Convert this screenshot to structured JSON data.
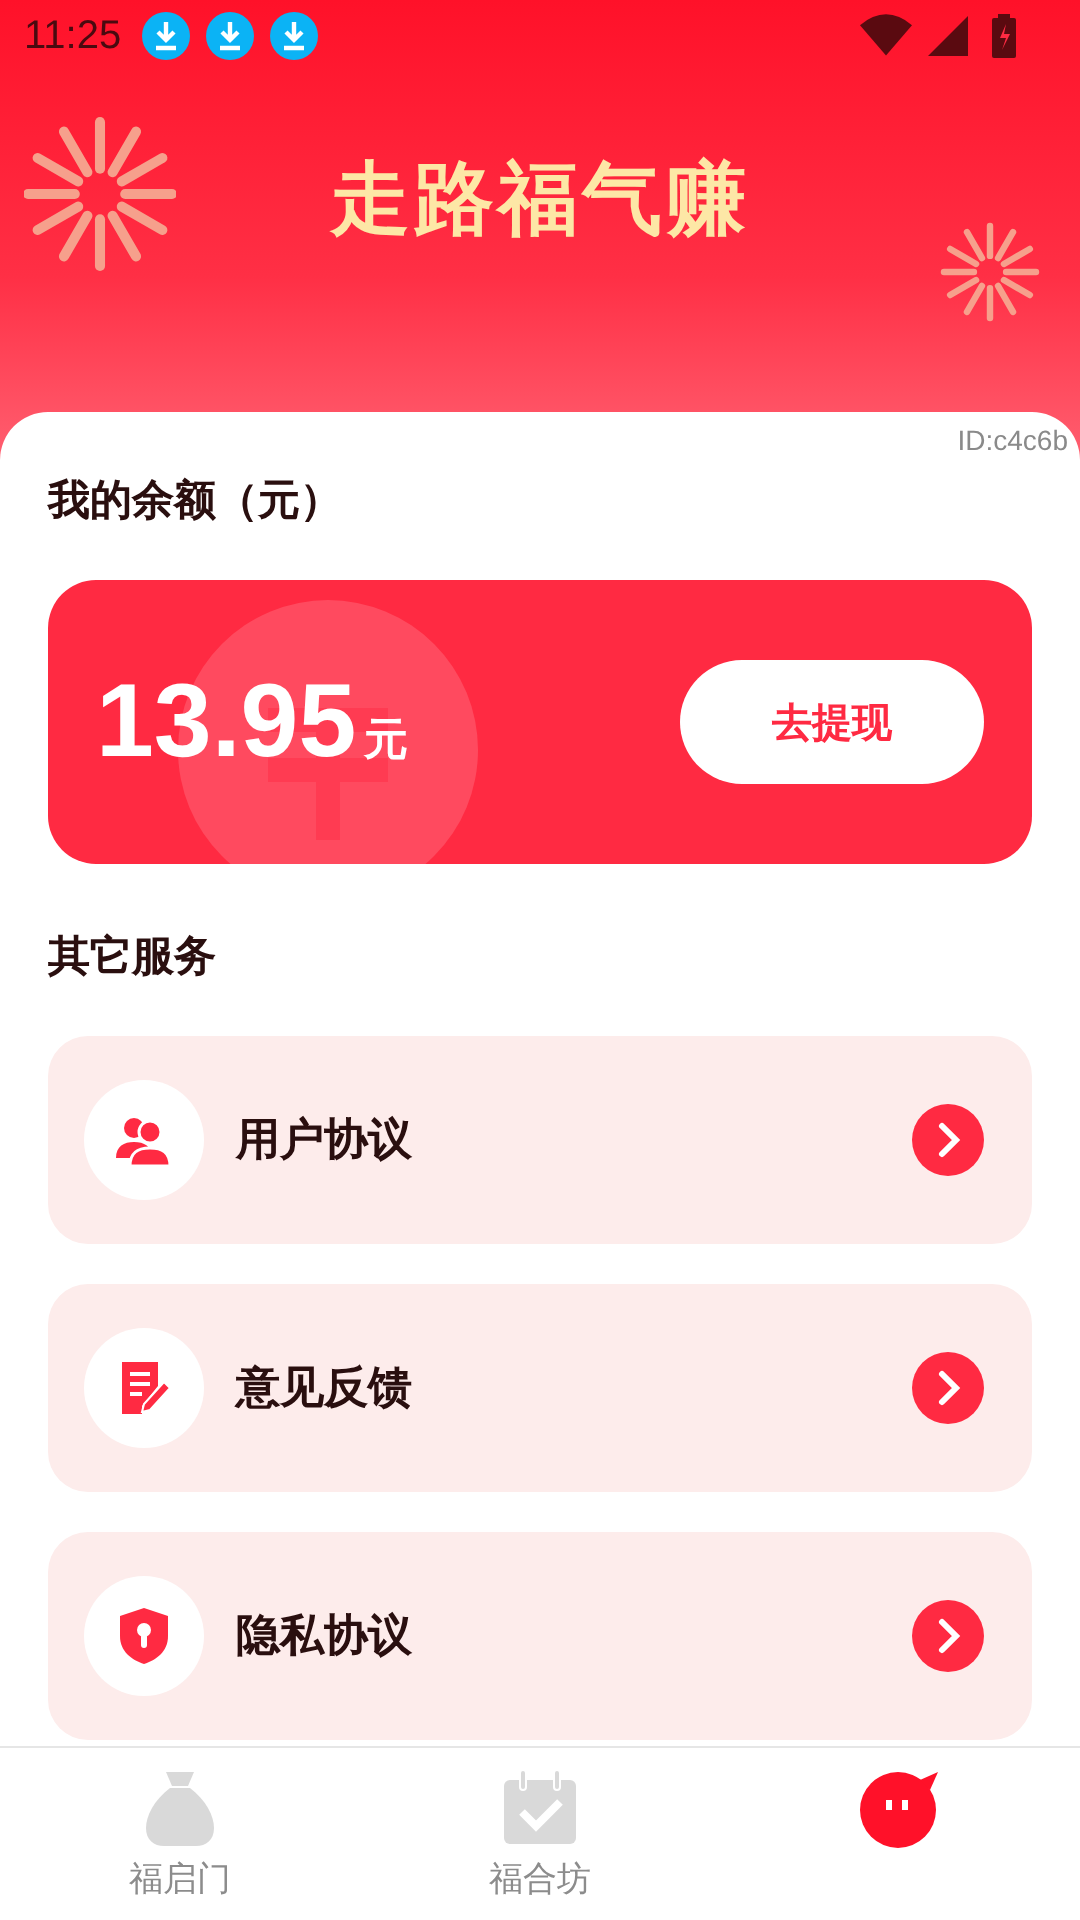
{
  "status_bar": {
    "time": "11:25"
  },
  "header": {
    "title": "走路福气赚",
    "id_label": "ID:c4c6b"
  },
  "balance": {
    "label": "我的余额（元）",
    "amount": "13.95",
    "unit": "元",
    "button": "去提现"
  },
  "services": {
    "title": "其它服务",
    "items": [
      {
        "label": "用户协议",
        "kind": "users"
      },
      {
        "label": "意见反馈",
        "kind": "feedback"
      },
      {
        "label": "隐私协议",
        "kind": "privacy"
      }
    ]
  },
  "tabs": [
    {
      "label": "福启门",
      "kind": "bag",
      "selected": false
    },
    {
      "label": "福合坊",
      "kind": "calendar",
      "selected": false
    },
    {
      "kind": "face",
      "selected": true
    }
  ]
}
